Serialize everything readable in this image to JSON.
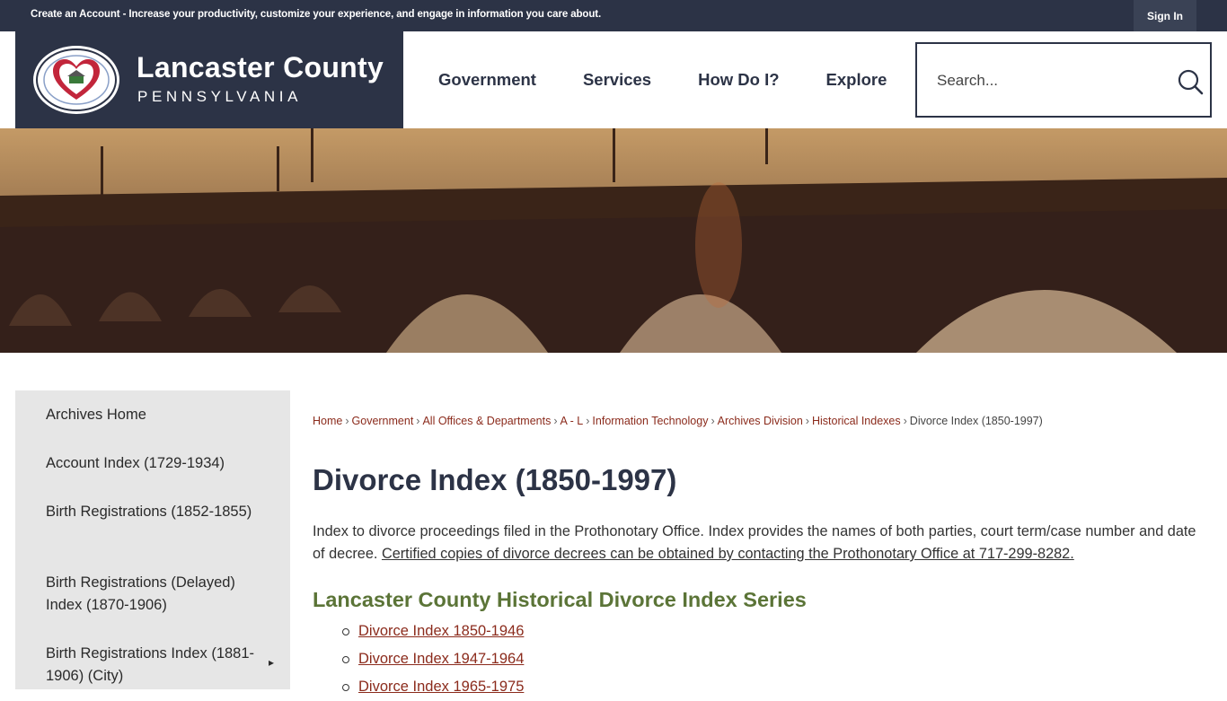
{
  "topbar": {
    "message": "Create an Account - Increase your productivity, customize your experience, and engage in information you care about.",
    "sign_in": "Sign In"
  },
  "brand": {
    "title": "Lancaster County",
    "subtitle": "PENNSYLVANIA"
  },
  "nav": {
    "items": [
      "Government",
      "Services",
      "How Do I?",
      "Explore"
    ]
  },
  "search": {
    "placeholder": "Search..."
  },
  "sidebar": {
    "items": [
      "Archives Home",
      "Account Index (1729-1934)",
      "Birth Registrations (1852-1855)",
      "Birth Registrations (Delayed) Index (1870-1906)",
      "Birth Registrations Index (1881-1906) (City)"
    ],
    "expand_arrow": "▸"
  },
  "breadcrumb": {
    "links": [
      "Home",
      "Government",
      "All Offices & Departments",
      "A - L",
      "Information Technology",
      "Archives Division",
      "Historical Indexes"
    ],
    "current": "Divorce Index (1850-1997)",
    "separator": "›"
  },
  "main": {
    "title": "Divorce Index (1850-1997)",
    "intro_text": "Index to divorce proceedings filed in the Prothonotary Office.  Index provides the names of both parties, court term/case number and date of decree. ",
    "intro_link": "Certified copies of divorce decrees can be obtained by contacting the Prothonotary Office at 717-299-8282.",
    "series_heading": "Lancaster County Historical Divorce Index Series",
    "series": [
      "Divorce Index 1850-1946",
      "Divorce Index 1947-1964",
      "Divorce Index 1965-1975"
    ]
  },
  "colors": {
    "navy": "#2c3346",
    "link_red": "#8b2b1c",
    "heading_green": "#5b7437",
    "sidebar_bg": "#e6e6e6"
  },
  "icons": {
    "search": "search-icon",
    "seal": "county-seal-icon",
    "expand": "caret-right-icon"
  }
}
